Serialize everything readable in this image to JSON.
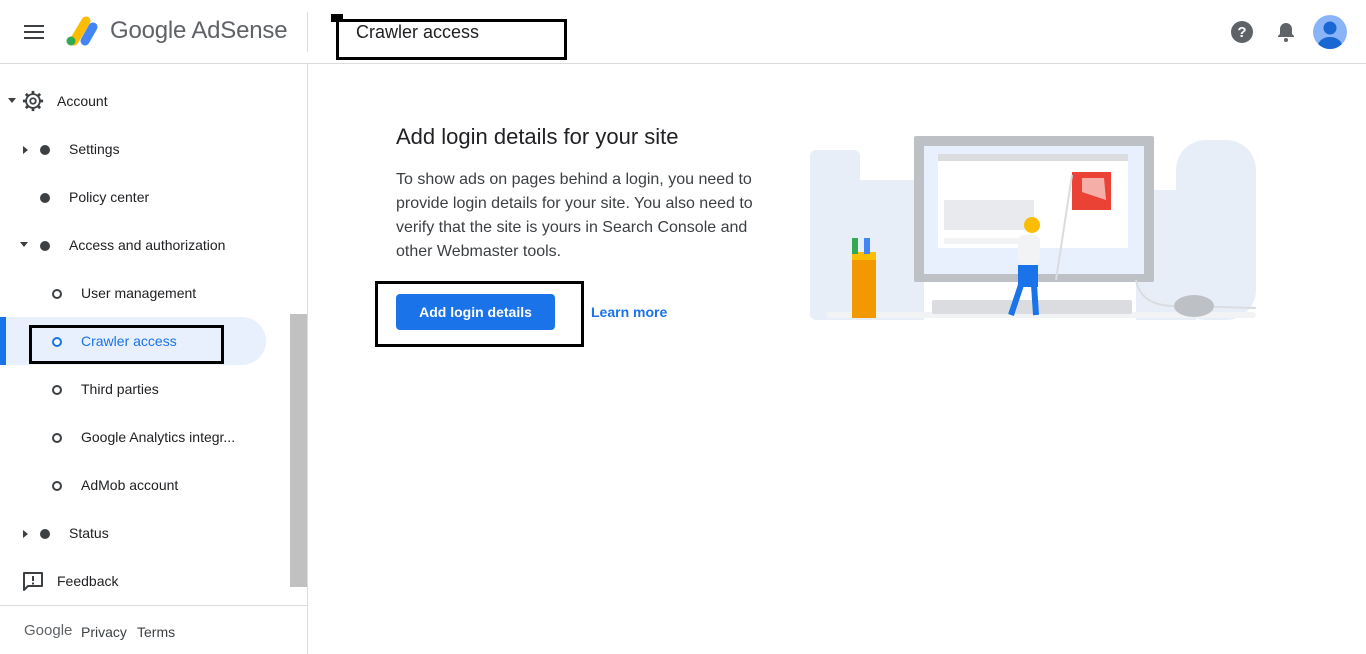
{
  "header": {
    "app_name": "Google AdSense",
    "page_title": "Crawler access",
    "help_icon": "help-icon",
    "notifications_icon": "bell-icon",
    "account_icon": "avatar-icon"
  },
  "sidebar": {
    "account": {
      "label": "Account",
      "icon": "gear-icon"
    },
    "settings": {
      "label": "Settings"
    },
    "policy_center": {
      "label": "Policy center"
    },
    "access_authorization": {
      "label": "Access and authorization"
    },
    "user_management": {
      "label": "User management"
    },
    "crawler_access": {
      "label": "Crawler access"
    },
    "third_parties": {
      "label": "Third parties"
    },
    "google_analytics": {
      "label": "Google Analytics integr..."
    },
    "admob": {
      "label": "AdMob account"
    },
    "status": {
      "label": "Status"
    },
    "feedback": {
      "label": "Feedback",
      "icon": "feedback-icon"
    }
  },
  "footer": {
    "google": "Google",
    "privacy": "Privacy",
    "terms": "Terms"
  },
  "main": {
    "heading": "Add login details for your site",
    "description": "To show ads on pages behind a login, you need to provide login details for your site. You also need to verify that the site is yours in Search Console and other Webmaster tools.",
    "primary_button": "Add login details",
    "learn_more": "Learn more"
  },
  "colors": {
    "accent": "#1a73e8",
    "active_bg": "#e8f0fe"
  }
}
